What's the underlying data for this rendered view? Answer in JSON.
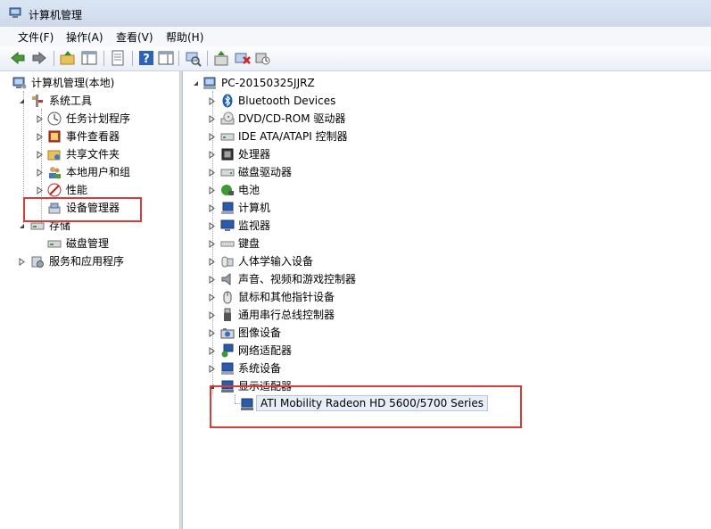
{
  "window": {
    "title": "计算机管理",
    "app_icon": "computer-management-icon"
  },
  "menu": [
    "文件(F)",
    "操作(A)",
    "查看(V)",
    "帮助(H)"
  ],
  "toolbar": [
    "back-arrow-icon",
    "forward-arrow-icon",
    "up-folder-icon",
    "show-hide-console-tree-icon",
    "properties-icon",
    "help-icon",
    "action-pane-icon",
    "scan-hardware-icon",
    "update-driver-icon",
    "uninstall-icon",
    "disable-device-icon"
  ],
  "left_tree": {
    "root": "计算机管理(本地)",
    "system_tools": "系统工具",
    "task_scheduler": "任务计划程序",
    "event_viewer": "事件查看器",
    "shared_folders": "共享文件夹",
    "local_users": "本地用户和组",
    "performance": "性能",
    "device_manager": "设备管理器",
    "storage": "存储",
    "disk_management": "磁盘管理",
    "services_apps": "服务和应用程序"
  },
  "device_tree": {
    "computer_name": "PC-20150325JJRZ",
    "categories": [
      "Bluetooth Devices",
      "DVD/CD-ROM 驱动器",
      "IDE ATA/ATAPI 控制器",
      "处理器",
      "磁盘驱动器",
      "电池",
      "计算机",
      "监视器",
      "键盘",
      "人体学输入设备",
      "声音、视频和游戏控制器",
      "鼠标和其他指针设备",
      "通用串行总线控制器",
      "图像设备",
      "网络适配器",
      "系统设备",
      "显示适配器"
    ],
    "display_adapter_device": "ATI Mobility Radeon HD 5600/5700 Series"
  }
}
